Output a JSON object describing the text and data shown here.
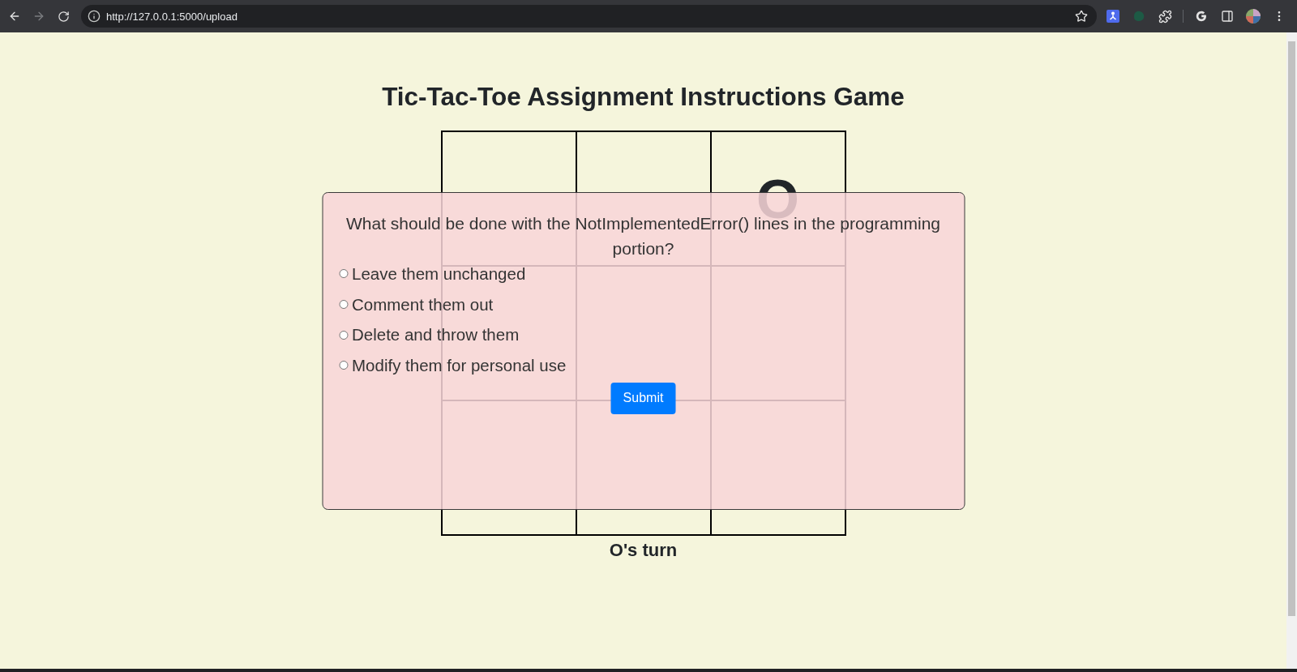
{
  "browser": {
    "back": {
      "disabled": false
    },
    "forward": {
      "disabled": true
    },
    "url": "http://127.0.0.1:5000/upload"
  },
  "game": {
    "title": "Tic-Tac-Toe Assignment Instructions Game",
    "cells": [
      null,
      null,
      "O",
      null,
      null,
      null,
      null,
      null,
      null
    ],
    "status": "O's turn"
  },
  "quiz": {
    "question": "What should be done with the NotImplementedError() lines in the programming portion?",
    "options": [
      {
        "label": "Leave them unchanged",
        "selected": false
      },
      {
        "label": "Comment them out",
        "selected": false
      },
      {
        "label": "Delete and throw them",
        "selected": false
      },
      {
        "label": "Modify them for personal use",
        "selected": false
      }
    ],
    "submit": "Submit"
  }
}
